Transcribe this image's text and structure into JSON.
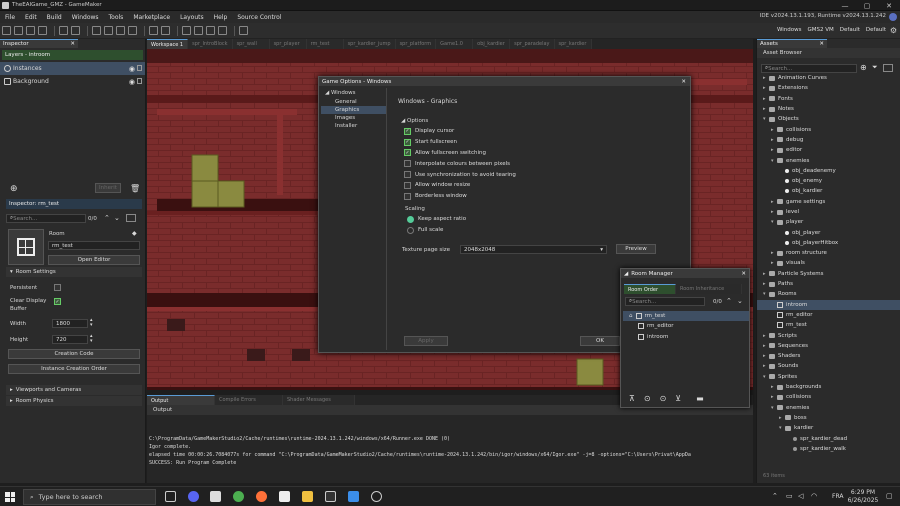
{
  "window": {
    "title": "TheEAIGame_GMZ - GameMaker",
    "min": "—",
    "max": "▢",
    "close": "✕"
  },
  "menu": [
    "File",
    "Edit",
    "Build",
    "Windows",
    "Tools",
    "Marketplace",
    "Layouts",
    "Help",
    "Source Control"
  ],
  "ide_version": "IDE v2024.13.1.193, Runtime v2024.13.1.242",
  "toolbar_right": [
    "Windows",
    "GMS2 VM",
    "Default",
    "Default"
  ],
  "inspector": {
    "tab": "Inspector",
    "layers_label": "Layers - introom",
    "layers": [
      {
        "name": "Instances"
      },
      {
        "name": "Background"
      }
    ],
    "inherit": "Inherit",
    "bottom_label": "Inspector: rm_test",
    "search_placeholder": "Search...",
    "count": "0/0",
    "room_label": "Room",
    "room_name": "rm_test",
    "open_editor": "Open Editor",
    "room_settings": "Room Settings",
    "persistent": "Persistent",
    "clear_display": "Clear Display",
    "buffer": "Buffer",
    "width_label": "Width",
    "width_value": "1800",
    "height_label": "Height",
    "height_value": "720",
    "creation_code": "Creation Code",
    "instance_order": "Instance Creation Order",
    "viewports": "Viewports and Cameras",
    "physics": "Room Physics"
  },
  "workspace_tabs": [
    "Workspace 1",
    "spr_IntroBlock",
    "spr_wall",
    "spr_player",
    "rm_test",
    "spr_kardier_jump",
    "spr_platform",
    "Game1.0",
    "obj_kardier",
    "spr_paradelay",
    "spr_kardier"
  ],
  "output": {
    "tabs": [
      "Output",
      "Compile Errors",
      "Shader Messages"
    ],
    "label": "Output",
    "log": [
      "C:\\ProgramData/GameMakerStudio2/Cache/runtimes\\runtime-2024.13.1.242/windows/x64/Runner.exe DONE (0)",
      "Igor complete.",
      "elapsed time 00:00:26.7084077s for command \"C:\\ProgramData/GameMakerStudio2/Cache/runtimes\\runtime-2024.13.1.242/bin/igor/windows/x64/Igor.exe\" -j=8 -options=\"C:\\Users\\Privat\\AppDa",
      "SUCCESS: Run Program Complete"
    ]
  },
  "game_options": {
    "title": "Game Options - Windows",
    "nav": {
      "root": "Windows",
      "items": [
        "General",
        "Graphics",
        "Images",
        "Installer"
      ],
      "selected": "Graphics"
    },
    "heading": "Windows - Graphics",
    "options_label": "Options",
    "options": [
      {
        "label": "Display cursor",
        "on": true
      },
      {
        "label": "Start fullscreen",
        "on": true
      },
      {
        "label": "Allow fullscreen switching",
        "on": true
      },
      {
        "label": "Interpolate colours between pixels",
        "on": false
      },
      {
        "label": "Use synchronization to avoid tearing",
        "on": false
      },
      {
        "label": "Allow window resize",
        "on": false
      },
      {
        "label": "Borderless window",
        "on": false
      }
    ],
    "scaling_label": "Scaling",
    "scaling": [
      {
        "label": "Keep aspect ratio",
        "on": true
      },
      {
        "label": "Full scale",
        "on": false
      }
    ],
    "texture_label": "Texture page size",
    "texture_value": "2048x2048",
    "preview": "Preview",
    "apply": "Apply",
    "ok": "OK"
  },
  "room_manager": {
    "title": "Room Manager",
    "tabs": [
      "Room Order",
      "Room Inheritance"
    ],
    "search_placeholder": "Search...",
    "count": "0/0",
    "rooms": [
      "rm_test",
      "rm_editor",
      "introom"
    ]
  },
  "assets": {
    "tab": "Assets",
    "browser": "Asset Browser",
    "search_placeholder": "Search...",
    "tree": [
      {
        "t": "Animation Curves",
        "d": 0,
        "k": "f"
      },
      {
        "t": "Extensions",
        "d": 0,
        "k": "f"
      },
      {
        "t": "Fonts",
        "d": 0,
        "k": "f"
      },
      {
        "t": "Notes",
        "d": 0,
        "k": "f"
      },
      {
        "t": "Objects",
        "d": 0,
        "k": "f",
        "open": true
      },
      {
        "t": "collisions",
        "d": 1,
        "k": "f"
      },
      {
        "t": "debug",
        "d": 1,
        "k": "f"
      },
      {
        "t": "editor",
        "d": 1,
        "k": "f"
      },
      {
        "t": "enemies",
        "d": 1,
        "k": "f",
        "open": true
      },
      {
        "t": "obj_deadenemy",
        "d": 2,
        "k": "o"
      },
      {
        "t": "obj_enemy",
        "d": 2,
        "k": "o"
      },
      {
        "t": "obj_kardier",
        "d": 2,
        "k": "o"
      },
      {
        "t": "game settings",
        "d": 1,
        "k": "f"
      },
      {
        "t": "level",
        "d": 1,
        "k": "f"
      },
      {
        "t": "player",
        "d": 1,
        "k": "f",
        "open": true
      },
      {
        "t": "obj_player",
        "d": 2,
        "k": "o"
      },
      {
        "t": "obj_playerHitbox",
        "d": 2,
        "k": "o"
      },
      {
        "t": "room structure",
        "d": 1,
        "k": "f"
      },
      {
        "t": "visuals",
        "d": 1,
        "k": "f"
      },
      {
        "t": "Particle Systems",
        "d": 0,
        "k": "f"
      },
      {
        "t": "Paths",
        "d": 0,
        "k": "f"
      },
      {
        "t": "Rooms",
        "d": 0,
        "k": "f",
        "open": true
      },
      {
        "t": "introom",
        "d": 1,
        "k": "r",
        "hl": true
      },
      {
        "t": "rm_editor",
        "d": 1,
        "k": "r"
      },
      {
        "t": "rm_test",
        "d": 1,
        "k": "r"
      },
      {
        "t": "Scripts",
        "d": 0,
        "k": "f"
      },
      {
        "t": "Sequences",
        "d": 0,
        "k": "f"
      },
      {
        "t": "Shaders",
        "d": 0,
        "k": "f"
      },
      {
        "t": "Sounds",
        "d": 0,
        "k": "f"
      },
      {
        "t": "Sprites",
        "d": 0,
        "k": "f",
        "open": true
      },
      {
        "t": "backgrounds",
        "d": 1,
        "k": "f"
      },
      {
        "t": "collisions",
        "d": 1,
        "k": "f"
      },
      {
        "t": "enemies",
        "d": 1,
        "k": "f",
        "open": true
      },
      {
        "t": "boss",
        "d": 2,
        "k": "f"
      },
      {
        "t": "kardier",
        "d": 2,
        "k": "f",
        "open": true
      },
      {
        "t": "spr_kardier_dead",
        "d": 3,
        "k": "s"
      },
      {
        "t": "spr_kardier_walk",
        "d": 3,
        "k": "s"
      }
    ],
    "footer": "63 items"
  },
  "taskbar": {
    "search": "Type here to search",
    "lang": "FRA",
    "time": "6:29 PM",
    "date": "6/26/2025"
  }
}
